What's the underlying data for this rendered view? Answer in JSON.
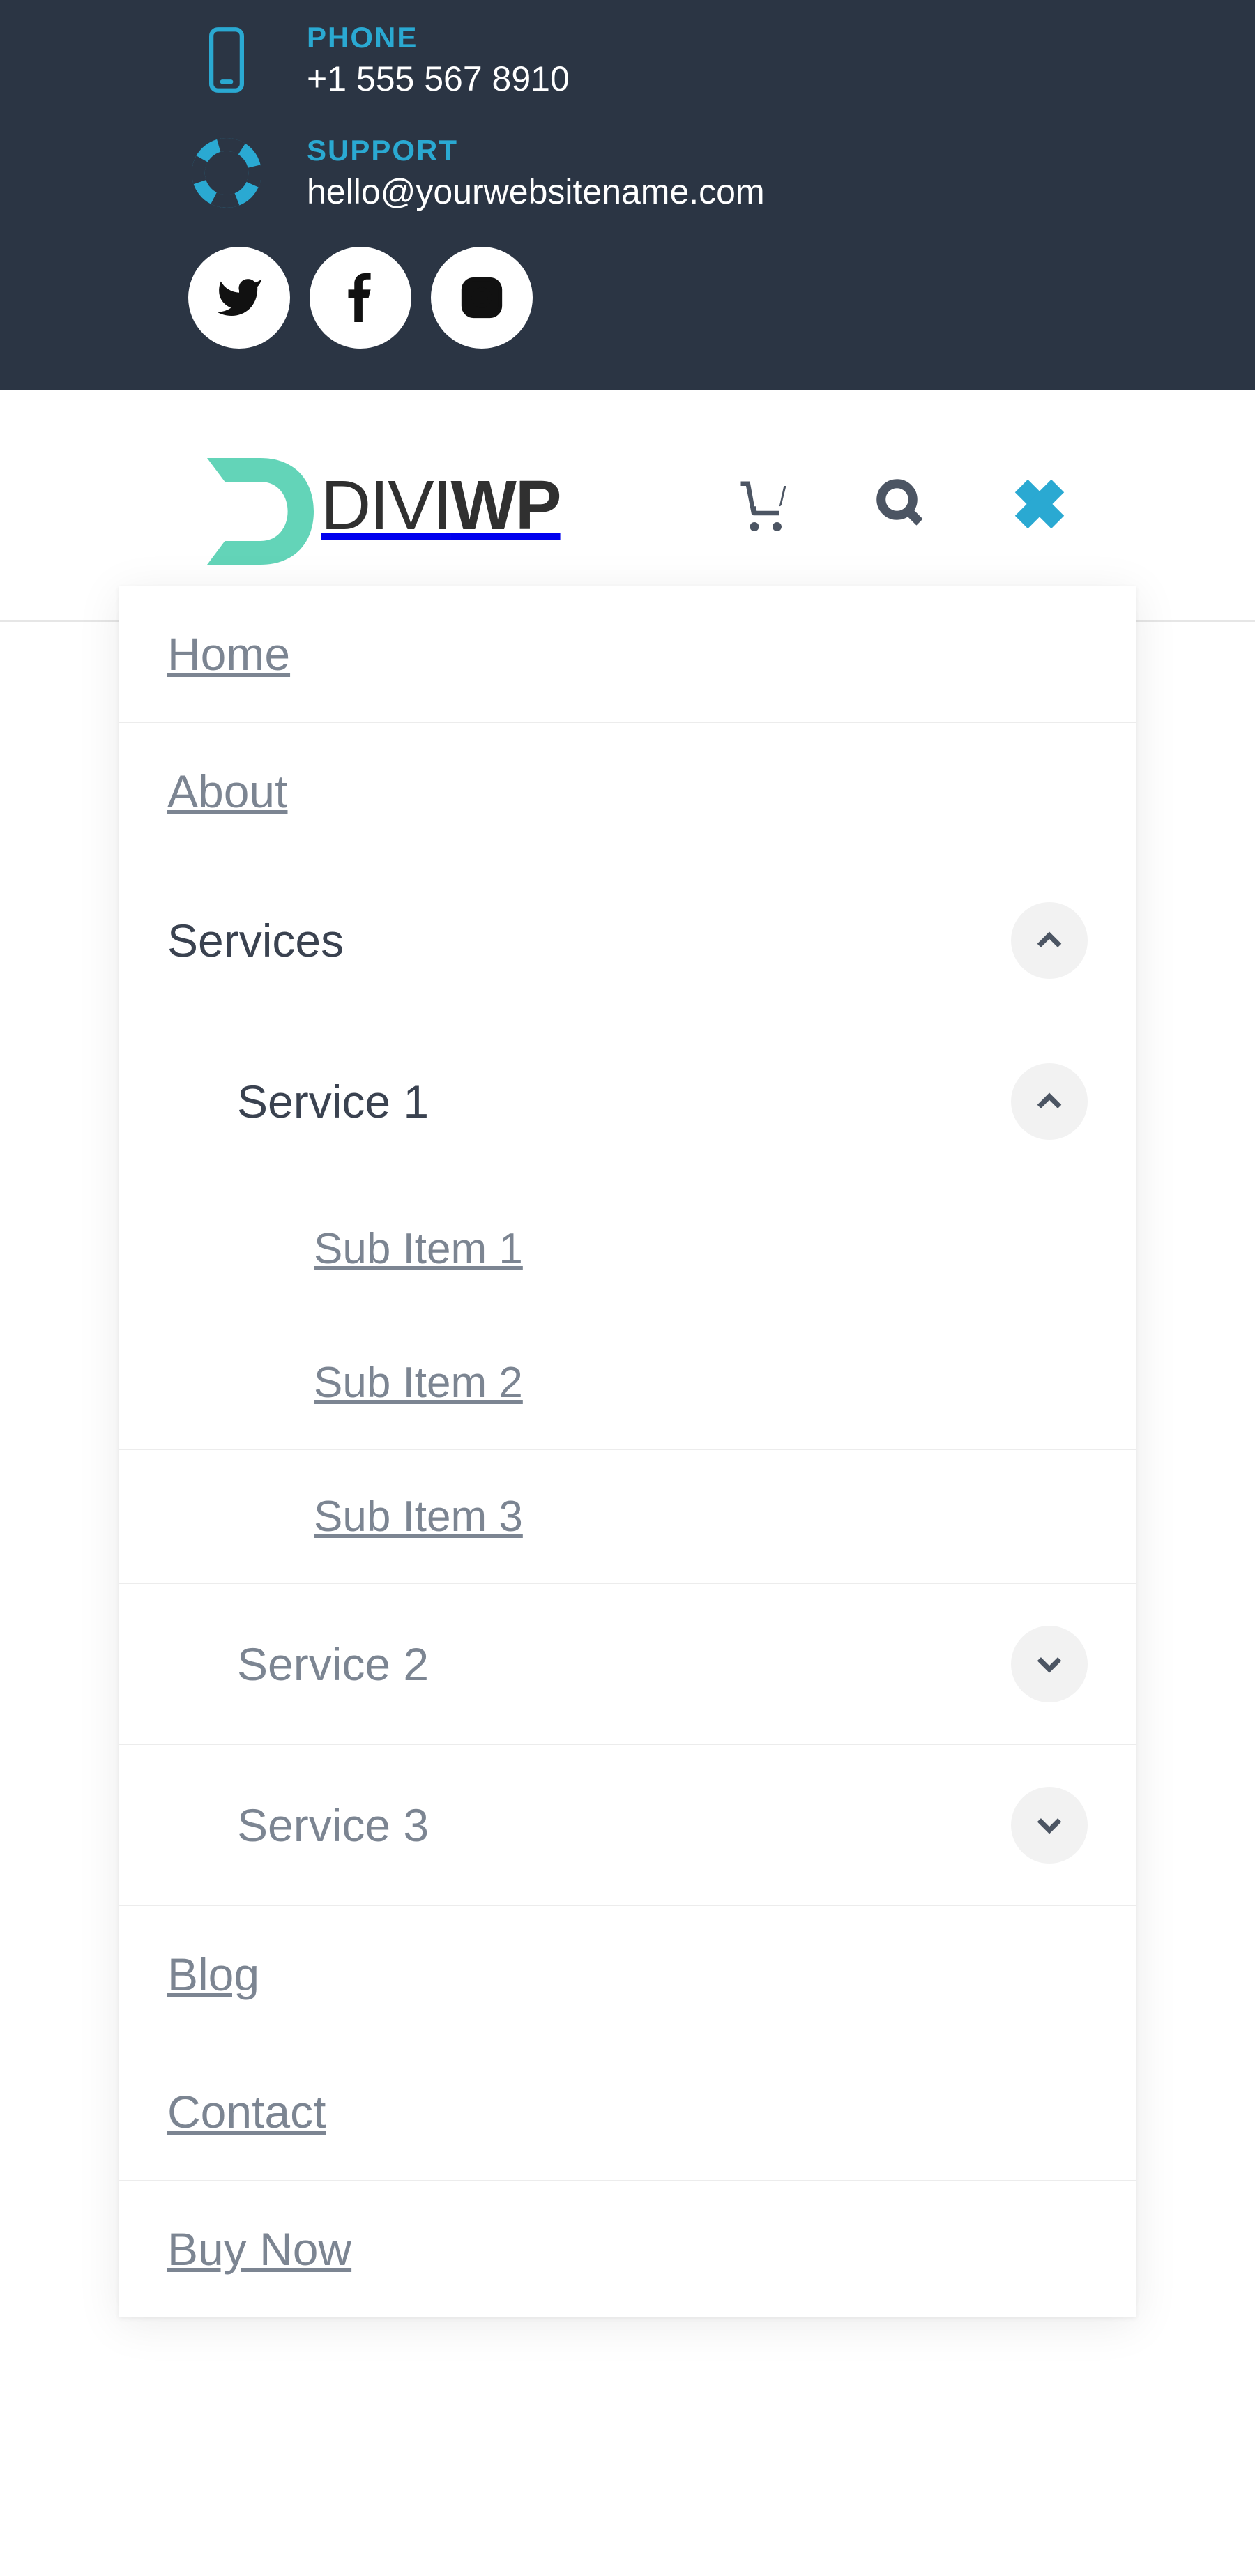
{
  "topbar": {
    "phone_label": "PHONE",
    "phone_value": "+1 555 567 8910",
    "support_label": "SUPPORT",
    "support_value": "hello@yourwebsitename.com",
    "socials": [
      {
        "name": "twitter"
      },
      {
        "name": "facebook"
      },
      {
        "name": "instagram"
      }
    ]
  },
  "logo": {
    "text1": "DIVI",
    "text2": "WP"
  },
  "header_icons": {
    "cart": "cart-icon",
    "search": "search-icon",
    "close": "close-icon"
  },
  "menu": {
    "home": "Home",
    "about": "About",
    "services": "Services",
    "service1": "Service 1",
    "sub1": "Sub Item 1",
    "sub2": "Sub Item 2",
    "sub3": "Sub Item 3",
    "service2": "Service 2",
    "service3": "Service 3",
    "blog": "Blog",
    "contact": "Contact",
    "buy": "Buy Now"
  }
}
